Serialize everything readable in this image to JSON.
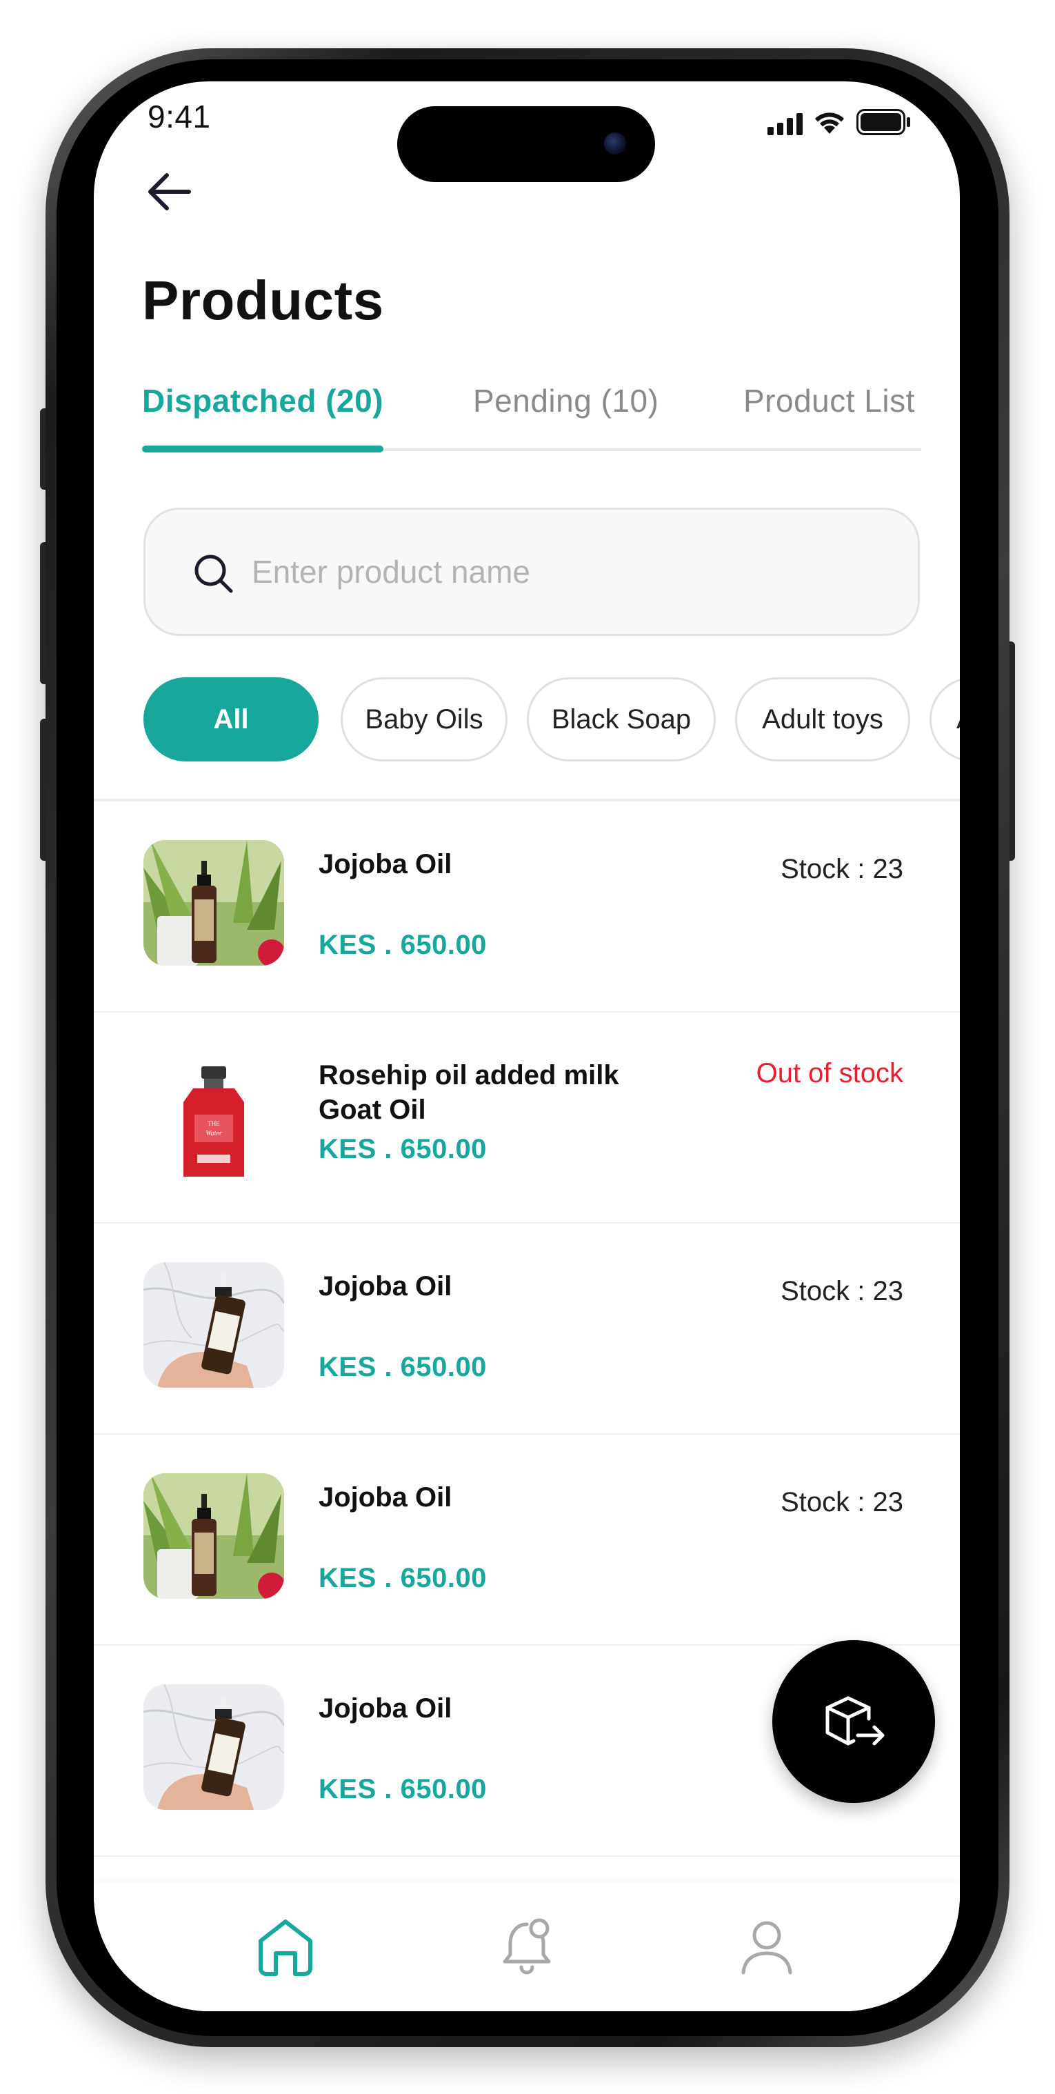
{
  "status_bar": {
    "time": "9:41"
  },
  "header": {
    "back_icon": "arrow-left-icon",
    "title": "Products"
  },
  "tabs": [
    {
      "label": "Dispatched  (20)",
      "active": true
    },
    {
      "label": "Pending (10)",
      "active": false
    },
    {
      "label": "Product List",
      "active": false
    }
  ],
  "search": {
    "placeholder": "Enter product name",
    "value": "",
    "icon": "search-icon"
  },
  "filters": [
    {
      "label": "All",
      "active": true
    },
    {
      "label": "Baby Oils",
      "active": false
    },
    {
      "label": "Black Soap",
      "active": false
    },
    {
      "label": "Adult toys",
      "active": false
    },
    {
      "label": "A",
      "active": false
    }
  ],
  "products": [
    {
      "name": "Jojoba Oil",
      "price": "KES . 650.00",
      "stock": "Stock : 23",
      "image": "spray-bottle-plant"
    },
    {
      "name": "Rosehip oil added milk Goat Oil",
      "price": "KES . 650.00",
      "stock": "Out of stock",
      "image": "red-bottle"
    },
    {
      "name": "Jojoba Oil",
      "price": "KES . 650.00",
      "stock": "Stock : 23",
      "image": "dropper-bottle-marble"
    },
    {
      "name": "Jojoba Oil",
      "price": "KES . 650.00",
      "stock": "Stock : 23",
      "image": "spray-bottle-plant"
    },
    {
      "name": "Jojoba Oil",
      "price": "KES . 650.00",
      "stock": "",
      "image": "dropper-bottle-marble"
    }
  ],
  "fab": {
    "icon": "box-export-icon"
  },
  "bottom_nav": [
    {
      "icon": "home-icon",
      "active": true
    },
    {
      "icon": "notification-bell-icon",
      "active": false
    },
    {
      "icon": "profile-icon",
      "active": false
    }
  ],
  "colors": {
    "accent": "#17a79b",
    "danger": "#e5202f",
    "text": "#111111",
    "muted": "#8a8a8a"
  }
}
